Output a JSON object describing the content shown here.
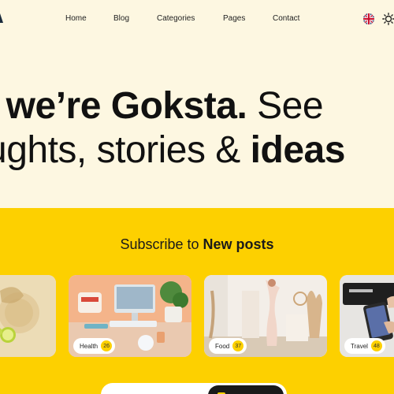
{
  "nav": {
    "links": [
      "Home",
      "Blog",
      "Categories",
      "Pages",
      "Contact"
    ]
  },
  "hero": {
    "line1_bold": ", we’re Goksta.",
    "line1_light": " See",
    "line2_light": "ughts, stories & ",
    "line2_bold": "ideas"
  },
  "subscribe": {
    "prefix": "Subscribe to ",
    "bold": "New posts"
  },
  "cards": [
    {
      "label": "",
      "count": ""
    },
    {
      "label": "Health",
      "count": "26"
    },
    {
      "label": "Food",
      "count": "37"
    },
    {
      "label": "Travel",
      "count": "48"
    }
  ],
  "colors": {
    "background": "#fdf7e1",
    "accent": "#fdd000",
    "text": "#1a1a1a"
  }
}
